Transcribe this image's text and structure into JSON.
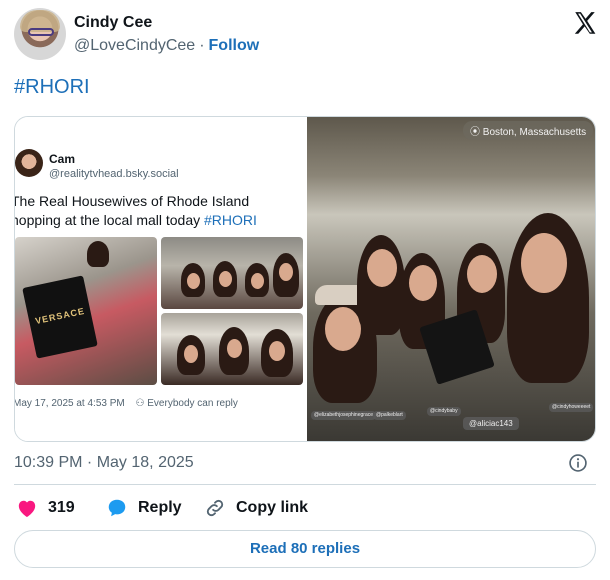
{
  "author": {
    "name": "Cindy Cee",
    "handle": "@LoveCindyCee",
    "follow_label": "Follow"
  },
  "post": {
    "hashtag": "#RHORI",
    "timestamp": "10:39 PM · May 18, 2025"
  },
  "embedded_post": {
    "name": "Cam",
    "handle": "@realitytvhead.bsky.social",
    "text_line1": "The Real Housewives of Rhode Island",
    "text_line2": "hopping at the local mall today",
    "hashtag": "#RHORI",
    "date": "May 17, 2025 at 4:53 PM",
    "reply_setting": "Everybody can reply",
    "bag_label": "VERSACE"
  },
  "photo": {
    "location": "Boston, Massachusetts",
    "tags": [
      "@elizabethjosephinegrace",
      "@palkeblart",
      "@cindybaby",
      "@cindyhoweeeet"
    ],
    "highlight_tag": "@aliciac143"
  },
  "actions": {
    "likes": "319",
    "reply_label": "Reply",
    "copy_label": "Copy link"
  },
  "read_replies": "Read 80 replies",
  "colors": {
    "accent": "#1d6fb8",
    "like": "#f91880",
    "reply_bubble": "#1d9bf0",
    "muted": "#536471"
  }
}
